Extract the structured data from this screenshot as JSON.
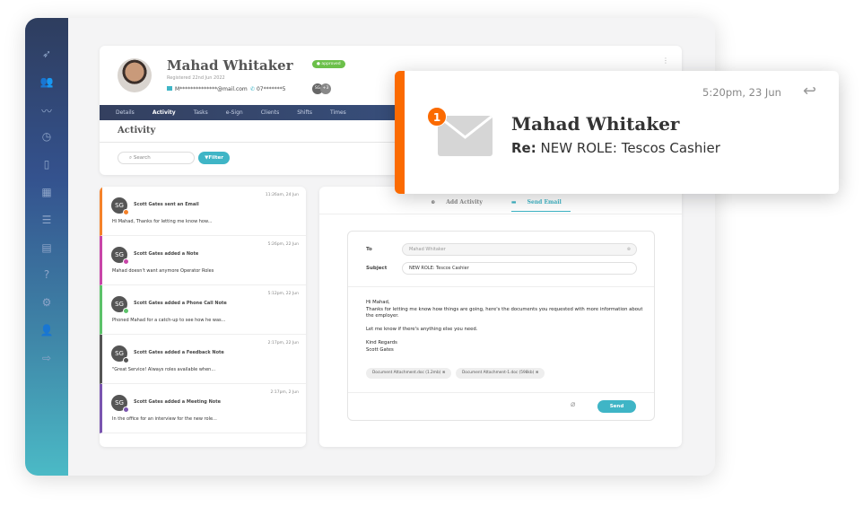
{
  "sidebar": {
    "icons": [
      "rocket-icon",
      "users-icon",
      "signature-icon",
      "clock-icon",
      "mobile-icon",
      "calendar-icon",
      "checklist-icon",
      "building-icon",
      "help-icon",
      "settings-icon",
      "user-icon",
      "logout-icon"
    ],
    "active": 1
  },
  "profile": {
    "name": "Mahad Whitaker",
    "registered": "Registered 22nd Jun 2022",
    "status": "approved",
    "email": "M**************@mail.com",
    "phone": "07*******5",
    "assignee_initials": "SG",
    "assignee_more": "+3"
  },
  "nav": {
    "tabs": [
      "Details",
      "Activity",
      "Tasks",
      "e-Sign",
      "Clients",
      "Shifts",
      "Times"
    ],
    "active": "Activity"
  },
  "activity": {
    "title": "Activity",
    "search_placeholder": "Search",
    "filter_label": "Filter"
  },
  "feed": [
    {
      "title": "Scott Gates sent an Email",
      "time": "11:26am, 24 Jun",
      "text": "Hi Mahad, Thanks for letting me know how...",
      "color": "#f5822a",
      "badge": "1"
    },
    {
      "title": "Scott Gates added a Note",
      "time": "5:26pm, 22 Jun",
      "text": "Mahad doesn't want anymore Operator Roles",
      "color": "#c845a8"
    },
    {
      "title": "Scott Gates added a Phone Call Note",
      "time": "5:12pm, 22 Jun",
      "text": "Phoned Mahad for a catch-up to see how he was...",
      "color": "#5cc26a"
    },
    {
      "title": "Scott Gates added a Feedback Note",
      "time": "2:17pm, 22 Jun",
      "text": "\"Great Service! Always roles available when...",
      "color": "#555555"
    },
    {
      "title": "Scott Gates added a Meeting Note",
      "time": "2:17pm, 2 Jun",
      "text": "In the office for an interview for the new role...",
      "color": "#7a55b0"
    }
  ],
  "compose": {
    "tab_add": "Add Activity",
    "tab_send": "Send Email",
    "to_label": "To",
    "to_value": "Mahad Whitaker",
    "subject_label": "Subject",
    "subject_value": "NEW ROLE: Tescos Cashier",
    "body": [
      "Hi Mahad,",
      "Thanks for letting me know how things are going, here's the documents you requested with more information about the employer.",
      "",
      "Let me know if there's anything else you need.",
      "",
      "Kind Regards",
      "Scott Gates"
    ],
    "attachments": [
      "Document Attachment.doc (1.2mb)",
      "Document Attachment-1.doc (598kb)"
    ],
    "send_label": "Send"
  },
  "notification": {
    "count": "1",
    "name": "Mahad Whitaker",
    "re_label": "Re:",
    "subject": "NEW ROLE: Tescos Cashier",
    "time": "5:20pm, 23 Jun",
    "accent": "#fb6a00"
  }
}
